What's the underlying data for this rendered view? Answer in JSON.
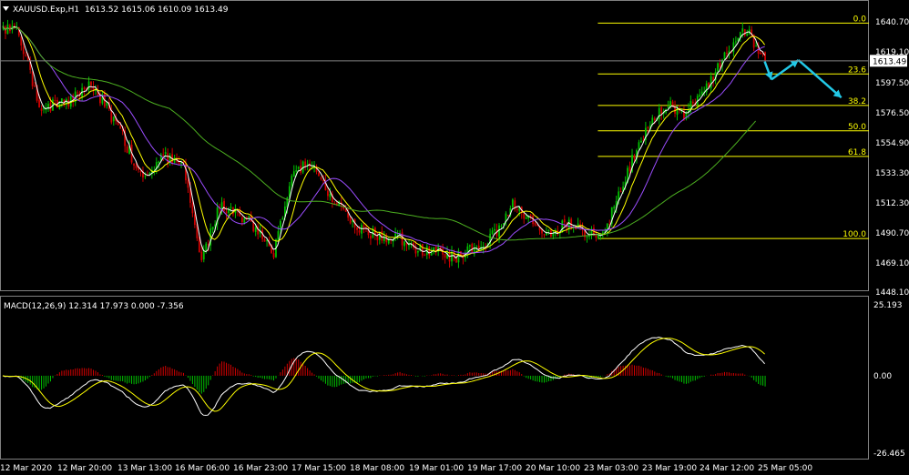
{
  "header": {
    "symbol": "XAUUSD.Exp,H1",
    "ohlc": "1613.52 1615.06 1610.09 1613.49"
  },
  "macd_header": {
    "label": "MACD(12,26,9) 12.314 17.973 0.000 -7.356"
  },
  "price_axis": {
    "labels": [
      "1640.70",
      "1619.10",
      "1597.50",
      "1576.50",
      "1554.90",
      "1533.30",
      "1512.30",
      "1490.70",
      "1469.10",
      "1448.10"
    ],
    "current_price": "1613.49"
  },
  "macd_axis": {
    "labels": [
      "25.193",
      "0.00",
      "-26.465"
    ]
  },
  "time_axis": {
    "labels": [
      "12 Mar 2020",
      "12 Mar 20:00",
      "13 Mar 13:00",
      "16 Mar 06:00",
      "16 Mar 23:00",
      "17 Mar 15:00",
      "18 Mar 08:00",
      "19 Mar 01:00",
      "19 Mar 17:00",
      "20 Mar 10:00",
      "23 Mar 03:00",
      "23 Mar 19:00",
      "24 Mar 12:00",
      "25 Mar 05:00"
    ]
  },
  "fibonacci": {
    "levels": [
      {
        "label": "0.0",
        "price": 1640.7
      },
      {
        "label": "23.6",
        "price": 1604.0
      },
      {
        "label": "38.2",
        "price": 1581.3
      },
      {
        "label": "50.0",
        "price": 1563.0
      },
      {
        "label": "61.8",
        "price": 1544.6
      },
      {
        "label": "100.0",
        "price": 1485.4
      }
    ]
  },
  "colors": {
    "background": "#000000",
    "bull_candle": "#00c000",
    "bear_candle": "#d00000",
    "ma_fast": "#ffffff",
    "ma_yellow": "#ffff00",
    "ma_violet": "#9b4dff",
    "ma_green": "#4caf20",
    "fib_line": "#ffff00",
    "arrow": "#22c8e6"
  },
  "chart_data": {
    "type": "candlestick",
    "symbol": "XAUUSD.Exp",
    "timeframe": "H1",
    "ylim": [
      1448.1,
      1656
    ],
    "anchors": [
      {
        "i": 0,
        "close": 1636
      },
      {
        "i": 6,
        "close": 1640
      },
      {
        "i": 16,
        "close": 1580
      },
      {
        "i": 28,
        "close": 1583
      },
      {
        "i": 38,
        "close": 1598
      },
      {
        "i": 44,
        "close": 1585
      },
      {
        "i": 52,
        "close": 1562
      },
      {
        "i": 62,
        "close": 1527
      },
      {
        "i": 70,
        "close": 1545
      },
      {
        "i": 80,
        "close": 1540
      },
      {
        "i": 88,
        "close": 1470
      },
      {
        "i": 96,
        "close": 1510
      },
      {
        "i": 104,
        "close": 1502
      },
      {
        "i": 110,
        "close": 1497
      },
      {
        "i": 120,
        "close": 1475
      },
      {
        "i": 128,
        "close": 1533
      },
      {
        "i": 136,
        "close": 1540
      },
      {
        "i": 146,
        "close": 1515
      },
      {
        "i": 156,
        "close": 1493
      },
      {
        "i": 166,
        "close": 1487
      },
      {
        "i": 176,
        "close": 1485
      },
      {
        "i": 184,
        "close": 1478
      },
      {
        "i": 192,
        "close": 1476
      },
      {
        "i": 200,
        "close": 1472
      },
      {
        "i": 210,
        "close": 1478
      },
      {
        "i": 218,
        "close": 1488
      },
      {
        "i": 226,
        "close": 1510
      },
      {
        "i": 234,
        "close": 1500
      },
      {
        "i": 242,
        "close": 1488
      },
      {
        "i": 250,
        "close": 1497
      },
      {
        "i": 258,
        "close": 1490
      },
      {
        "i": 266,
        "close": 1487
      },
      {
        "i": 276,
        "close": 1530
      },
      {
        "i": 286,
        "close": 1568
      },
      {
        "i": 296,
        "close": 1582
      },
      {
        "i": 302,
        "close": 1575
      },
      {
        "i": 310,
        "close": 1590
      },
      {
        "i": 318,
        "close": 1610
      },
      {
        "i": 326,
        "close": 1632
      },
      {
        "i": 330,
        "close": 1637
      },
      {
        "i": 334,
        "close": 1622
      },
      {
        "i": 338,
        "close": 1613.49
      }
    ],
    "forecast_path": [
      {
        "i": 338,
        "price": 1613
      },
      {
        "i": 341,
        "price": 1600
      },
      {
        "i": 353,
        "price": 1614
      },
      {
        "i": 372,
        "price": 1587
      }
    ],
    "macd": {
      "name": "MACD(12,26,9)",
      "main": 12.314,
      "signal": 17.973,
      "ylim": [
        -26.465,
        25.193
      ]
    }
  }
}
